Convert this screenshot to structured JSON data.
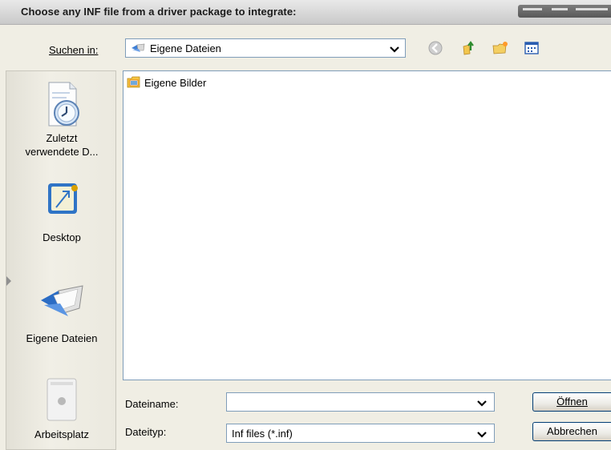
{
  "window": {
    "title": "Choose any INF file from a driver package to integrate:"
  },
  "look_in": {
    "label": "Suchen in:",
    "value": "Eigene Dateien",
    "icon": "my-documents-icon"
  },
  "toolbar": {
    "buttons": [
      {
        "name": "back-icon"
      },
      {
        "name": "up-folder-icon"
      },
      {
        "name": "new-folder-icon"
      },
      {
        "name": "view-menu-icon"
      }
    ]
  },
  "places": [
    {
      "label_line1": "Zuletzt",
      "label_line2": "verwendete D...",
      "icon": "recent-documents-icon"
    },
    {
      "label_line1": "Desktop",
      "label_line2": "",
      "icon": "desktop-icon"
    },
    {
      "label_line1": "Eigene Dateien",
      "label_line2": "",
      "icon": "my-documents-icon"
    },
    {
      "label_line1": "Arbeitsplatz",
      "label_line2": "",
      "icon": "my-computer-icon"
    }
  ],
  "files": [
    {
      "name": "Eigene Bilder",
      "icon": "my-pictures-folder-icon"
    }
  ],
  "filename": {
    "label": "Dateiname:",
    "value": ""
  },
  "filetype": {
    "label": "Dateityp:",
    "value": "Inf files (*.inf)"
  },
  "buttons": {
    "open": "Öffnen",
    "cancel": "Abbrechen"
  }
}
